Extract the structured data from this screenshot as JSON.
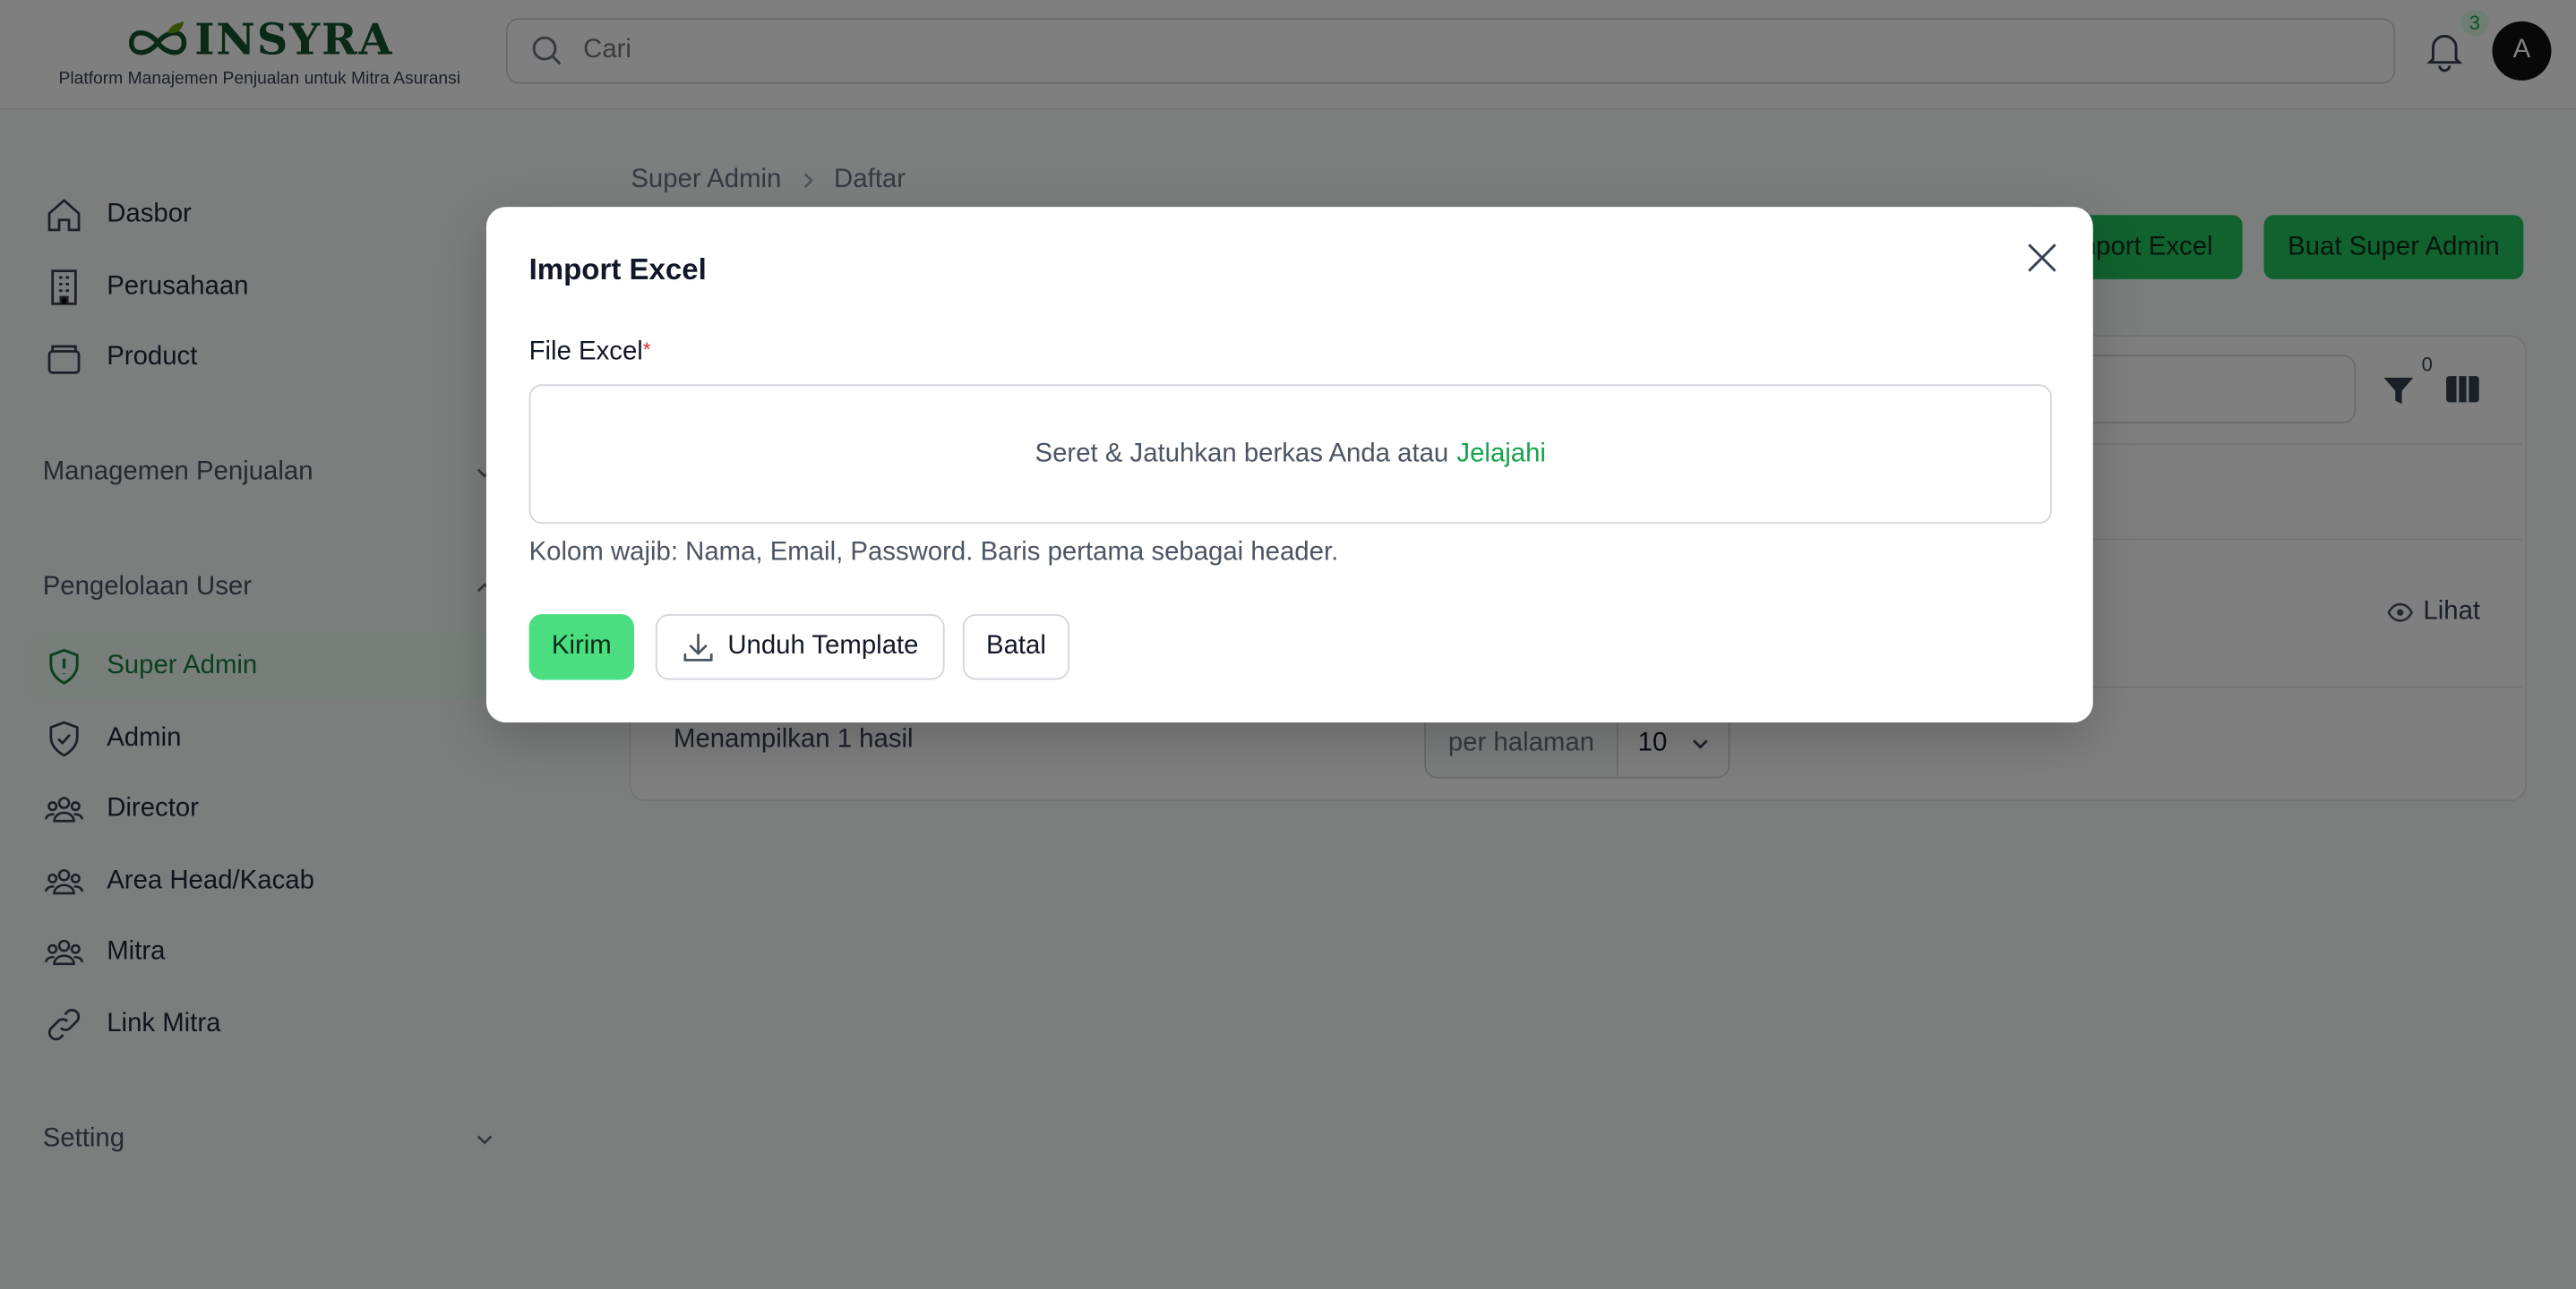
{
  "brand": {
    "name": "INSYRA",
    "tagline": "Platform Manajemen Penjualan untuk Mitra Asuransi",
    "color": "#14532d"
  },
  "header": {
    "search_placeholder": "Cari",
    "notification_count": "3",
    "avatar_initial": "A"
  },
  "sidebar": {
    "items": [
      {
        "label": "Dasbor",
        "icon": "home-icon"
      },
      {
        "label": "Perusahaan",
        "icon": "building-icon"
      },
      {
        "label": "Product",
        "icon": "box-icon"
      }
    ],
    "groups": {
      "sales": "Managemen Penjualan",
      "users": "Pengelolaan User",
      "setting": "Setting"
    },
    "user_items": [
      {
        "label": "Super Admin",
        "icon": "shield-alert-icon",
        "active": true
      },
      {
        "label": "Admin",
        "icon": "shield-check-icon"
      },
      {
        "label": "Director",
        "icon": "users-icon"
      },
      {
        "label": "Area Head/Kacab",
        "icon": "users-icon"
      },
      {
        "label": "Mitra",
        "icon": "users-icon"
      },
      {
        "label": "Link Mitra",
        "icon": "link-icon"
      }
    ]
  },
  "page": {
    "breadcrumb": [
      "Super Admin",
      "Daftar"
    ],
    "import_button": "Import Excel",
    "create_button": "Buat Super Admin",
    "filter_count": "0",
    "view_action": "Lihat",
    "showing": "Menampilkan 1 hasil",
    "per_page_label": "per halaman",
    "per_page_value": "10"
  },
  "modal": {
    "title": "Import Excel",
    "field_label": "File Excel",
    "required_mark": "*",
    "dropzone_text": "Seret & Jatuhkan berkas Anda atau",
    "dropzone_browse": "Jelajahi",
    "hint": "Kolom wajib: Nama, Email, Password. Baris pertama sebagai header.",
    "submit": "Kirim",
    "download_template": "Unduh Template",
    "cancel": "Batal"
  },
  "colors": {
    "accent": "#22c55e",
    "accent_text": "#16a34a"
  }
}
